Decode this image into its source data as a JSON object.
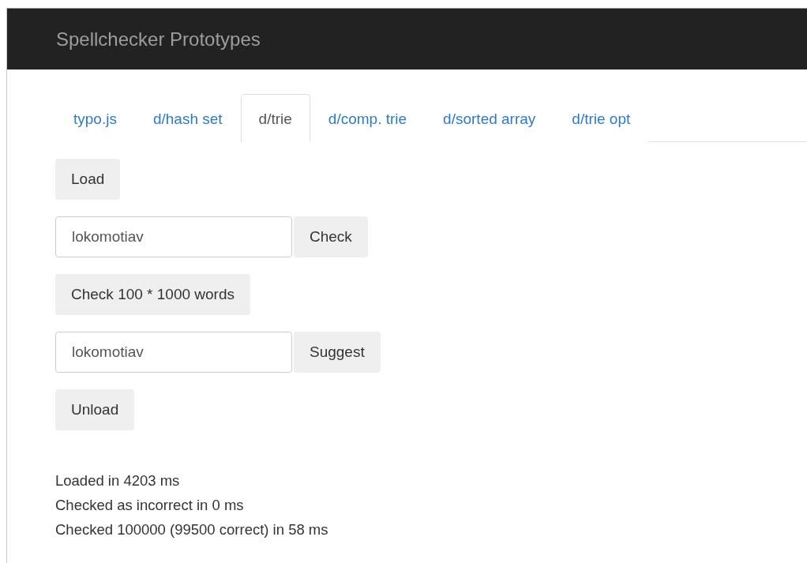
{
  "navbar": {
    "title": "Spellchecker Prototypes"
  },
  "tabs": [
    {
      "label": "typo.js",
      "selected": false
    },
    {
      "label": "d/hash set",
      "selected": false
    },
    {
      "label": "d/trie",
      "selected": true
    },
    {
      "label": "d/comp. trie",
      "selected": false
    },
    {
      "label": "d/sorted array",
      "selected": false
    },
    {
      "label": "d/trie opt",
      "selected": false
    }
  ],
  "controls": [
    {
      "kind": "button",
      "label": "Load"
    },
    {
      "kind": "input_button",
      "value": "lokomotiav",
      "label": "Check"
    },
    {
      "kind": "button",
      "label": "Check 100 * 1000 words"
    },
    {
      "kind": "input_button",
      "value": "lokomotiav",
      "label": "Suggest"
    },
    {
      "kind": "button",
      "label": "Unload"
    }
  ],
  "log": [
    "Loaded in 4203 ms",
    "Checked as incorrect in 0 ms",
    "Checked 100000 (99500 correct) in 58 ms"
  ]
}
